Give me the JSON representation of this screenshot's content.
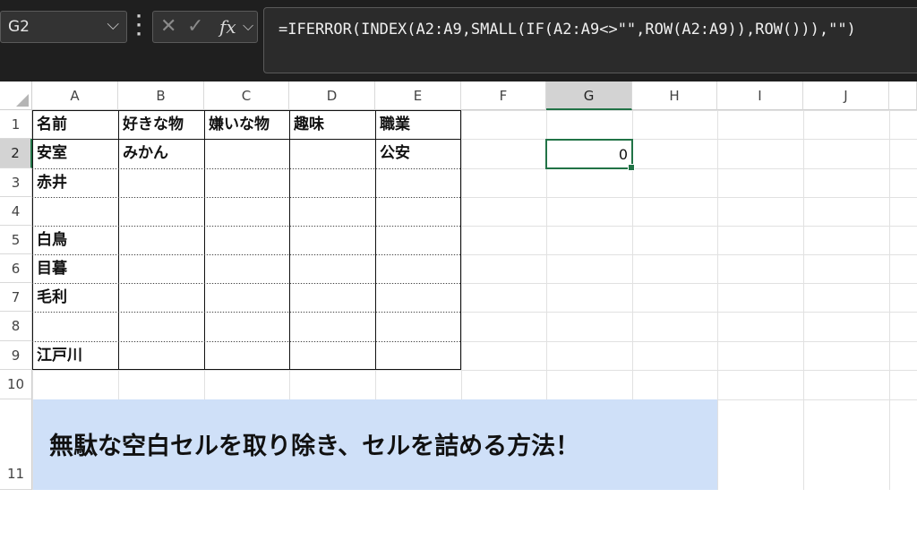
{
  "name_box": {
    "value": "G2"
  },
  "formula_bar": {
    "cancel_icon": "close-icon",
    "confirm_icon": "check-icon",
    "fx_label": "fx",
    "formula": "=IFERROR(INDEX(A2:A9,SMALL(IF(A2:A9<>\"\",ROW(A2:A9)),ROW())),\"\")"
  },
  "columns": [
    "A",
    "B",
    "C",
    "D",
    "E",
    "F",
    "G",
    "H",
    "I",
    "J"
  ],
  "selected_column": "G",
  "rows": [
    "1",
    "2",
    "3",
    "4",
    "5",
    "6",
    "7",
    "8",
    "9",
    "10",
    "11"
  ],
  "selected_row": "2",
  "table": {
    "headers": [
      "名前",
      "好きな物",
      "嫌いな物",
      "趣味",
      "職業"
    ],
    "rows": [
      [
        "安室",
        "みかん",
        "",
        "",
        "公安"
      ],
      [
        "赤井",
        "",
        "",
        "",
        ""
      ],
      [
        "",
        "",
        "",
        "",
        ""
      ],
      [
        "白鳥",
        "",
        "",
        "",
        ""
      ],
      [
        "目暮",
        "",
        "",
        "",
        ""
      ],
      [
        "毛利",
        "",
        "",
        "",
        ""
      ],
      [
        "",
        "",
        "",
        "",
        ""
      ],
      [
        "江戸川",
        "",
        "",
        "",
        ""
      ]
    ]
  },
  "active_cell": {
    "ref": "G2",
    "value": "0"
  },
  "banner": {
    "text": "無駄な空白セルを取り除き、セルを詰める方法！"
  },
  "colors": {
    "accent": "#217346",
    "banner": "#cfe0f8",
    "toolbar": "#1f1f1f"
  }
}
